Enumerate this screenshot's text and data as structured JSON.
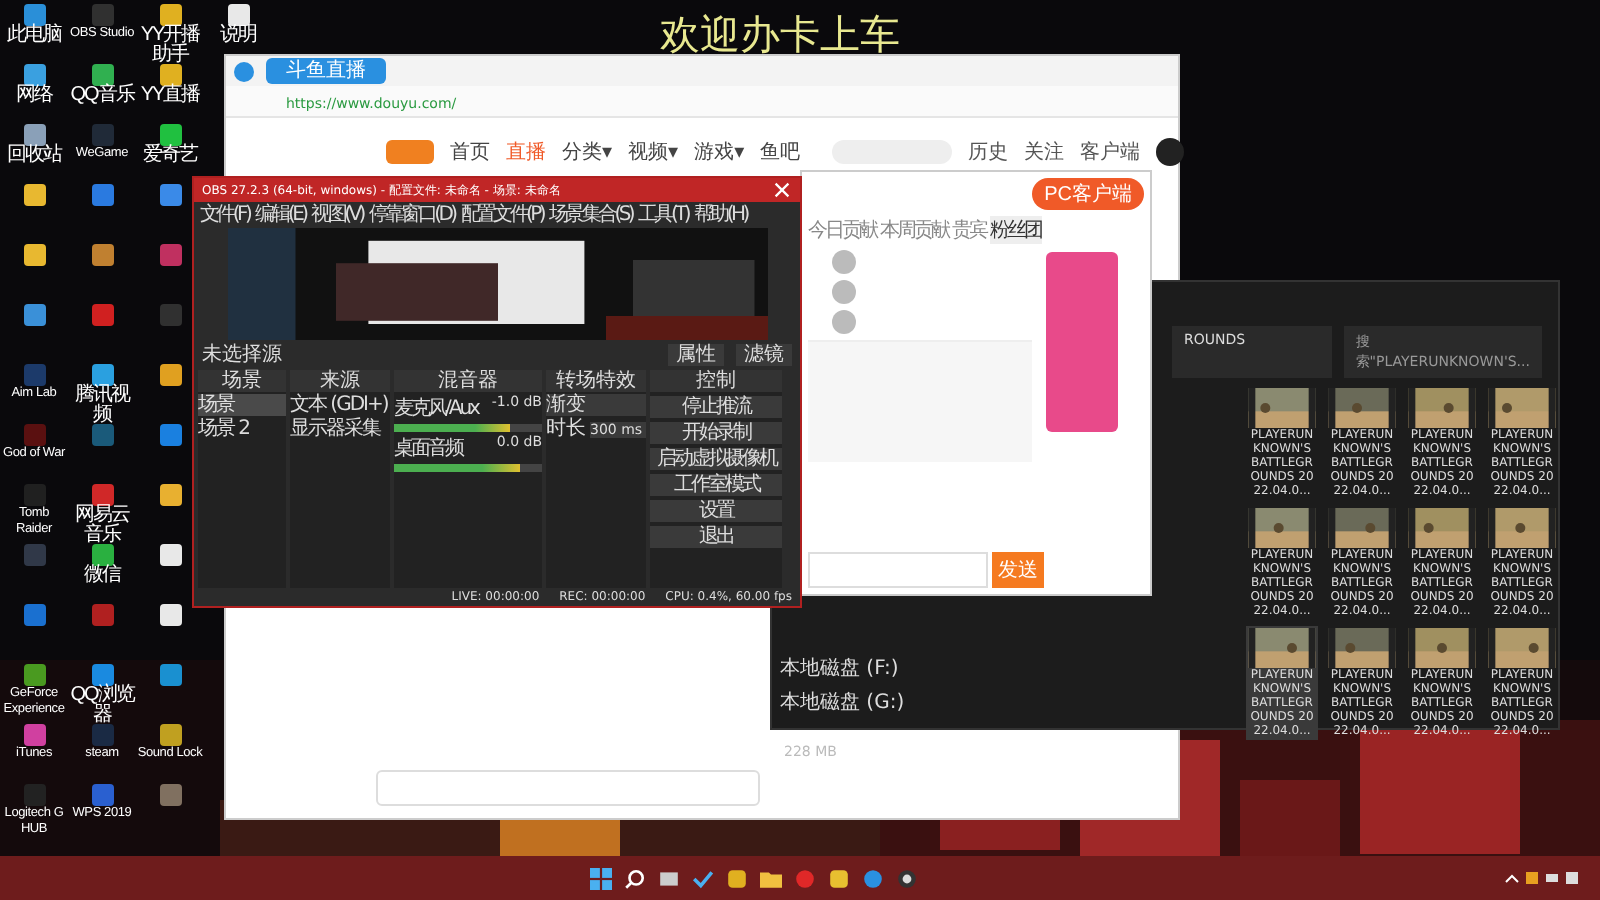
{
  "overlay_title": "欢迎办卡上车",
  "desktop_columns": [
    [
      {
        "label": "此电脑",
        "color": "#2a8fd8"
      },
      {
        "label": "网络",
        "color": "#3aa0e0"
      },
      {
        "label": "回收站",
        "color": "#8aa0b8"
      },
      {
        "color": "#e8b830"
      },
      {
        "color": "#e8b830"
      },
      {
        "color": "#3a90d8"
      },
      {
        "label": "Aim Lab",
        "color": "#1c3a6a"
      },
      {
        "label": "God of War",
        "color": "#5a1010"
      },
      {
        "label": "Tomb Raider",
        "color": "#202020"
      },
      {
        "color": "#303848"
      },
      {
        "color": "#1a70d0"
      },
      {
        "label": "GeForce Experience",
        "color": "#4a9a20"
      },
      {
        "label": "iTunes",
        "color": "#d040a0"
      },
      {
        "label": "Logitech G HUB",
        "color": "#222222"
      }
    ],
    [
      {
        "label": "OBS Studio",
        "color": "#303030"
      },
      {
        "label": "QQ音乐",
        "color": "#30b050"
      },
      {
        "label": "WeGame",
        "color": "#202a38"
      },
      {
        "color": "#2a7ae0"
      },
      {
        "color": "#c08030"
      },
      {
        "color": "#d02020"
      },
      {
        "label": "腾讯视频",
        "color": "#2aa0e0"
      },
      {
        "color": "#1a5a7a"
      },
      {
        "label": "网易云音乐",
        "color": "#d02828"
      },
      {
        "label": "微信",
        "color": "#2ab040"
      },
      {
        "color": "#b02020"
      },
      {
        "label": "QQ浏览器",
        "color": "#1a8ae0"
      },
      {
        "label": "steam",
        "color": "#1a2a44"
      },
      {
        "label": "WPS 2019",
        "color": "#2a60d0"
      }
    ],
    [
      {
        "label": "YY开播助手",
        "color": "#e0b020"
      },
      {
        "label": "YY直播",
        "color": "#e0b020"
      },
      {
        "label": "爱奇艺",
        "color": "#20c040"
      },
      {
        "color": "#3a8ae8"
      },
      {
        "color": "#c03060"
      },
      {
        "color": "#303030"
      },
      {
        "color": "#e0a020"
      },
      {
        "color": "#1a80e0"
      },
      {
        "color": "#e8b030"
      },
      {
        "color": "#e8e8e8"
      },
      {
        "color": "#e8e8e8"
      },
      {
        "color": "#1a90d0"
      },
      {
        "label": "Sound Lock",
        "color": "#c0a020"
      },
      {
        "color": "#807060"
      }
    ],
    [
      {
        "label": "说明",
        "color": "#e8e8e8"
      }
    ]
  ],
  "browser": {
    "tab": "斗鱼直播",
    "url": "https://www.douyu.com/",
    "nav": [
      {
        "label": "首页",
        "selected": false
      },
      {
        "label": "直播",
        "selected": true
      },
      {
        "label": "分类▾",
        "selected": false
      },
      {
        "label": "视频▾",
        "selected": false
      },
      {
        "label": "游戏▾",
        "selected": false
      },
      {
        "label": "鱼吧",
        "selected": false
      }
    ],
    "actions": [
      "历史",
      "关注",
      "客户端"
    ]
  },
  "chat_window": {
    "client_button": "PC客户端",
    "tabs": [
      {
        "label": "今日贡献",
        "selected": false
      },
      {
        "label": "本周贡献",
        "selected": false
      },
      {
        "label": "贵宾",
        "selected": false
      },
      {
        "label": "粉丝团",
        "selected": true
      }
    ],
    "send": "发送"
  },
  "obs": {
    "title": "OBS 27.2.3 (64-bit, windows) - 配置文件: 未命名 - 场景: 未命名",
    "menu": [
      "文件(F)",
      "编辑(E)",
      "视图(V)",
      "停靠窗口(D)",
      "配置文件(P)",
      "场景集合(S)",
      "工具(T)",
      "帮助(H)"
    ],
    "no_source": "未选择源",
    "source_buttons": [
      "属性",
      "滤镜"
    ],
    "panels": {
      "scenes": "场景",
      "sources": "来源",
      "mixer": "混音器",
      "transitions": "转场特效",
      "controls": "控制"
    },
    "scenes": [
      {
        "label": "场景",
        "selected": true
      },
      {
        "label": "场景 2",
        "selected": false
      }
    ],
    "sources": [
      "文本 (GDI+)",
      "显示器采集"
    ],
    "mixer": [
      {
        "name": "麦克风/Aux",
        "reading": "-1.0 dB",
        "level": 0.78
      },
      {
        "name": "桌面音频",
        "reading": "0.0 dB",
        "level": 0.85
      }
    ],
    "transition": {
      "value": "渐变",
      "duration_label": "时长",
      "duration": "300 ms"
    },
    "controls": [
      "停止推流",
      "开始录制",
      "启动虚拟摄像机",
      "工作室模式",
      "设置",
      "退出"
    ],
    "status": [
      "LIVE: 00:00:00",
      "REC: 00:00:00",
      "CPU: 0.4%, 60.00 fps"
    ]
  },
  "explorer": {
    "path": "ROUNDS",
    "search": "搜索\"PLAYERUNKNOWN'S...",
    "drives": [
      "本地磁盘 (F:)",
      "本地磁盘 (G:)"
    ],
    "items": [
      {
        "label": "PLAYERUNKNOWN'S BATTLEGROUNDS 2022.04.0...",
        "selected": false
      },
      {
        "label": "PLAYERUNKNOWN'S BATTLEGROUNDS 2022.04.0...",
        "selected": false
      },
      {
        "label": "PLAYERUNKNOWN'S BATTLEGROUNDS 2022.04.0...",
        "selected": false
      },
      {
        "label": "PLAYERUNKNOWN'S BATTLEGROUNDS 2022.04.0...",
        "selected": false
      },
      {
        "label": "PLAYERUNKNOWN'S BATTLEGROUNDS 2022.04.0...",
        "selected": false
      },
      {
        "label": "PLAYERUNKNOWN'S BATTLEGROUNDS 2022.04.0...",
        "selected": false
      },
      {
        "label": "PLAYERUNKNOWN'S BATTLEGROUNDS 2022.04.0...",
        "selected": false
      },
      {
        "label": "PLAYERUNKNOWN'S BATTLEGROUNDS 2022.04.0...",
        "selected": false
      },
      {
        "label": "PLAYERUNKNOWN'S BATTLEGROUNDS 2022.04.0...",
        "selected": true
      },
      {
        "label": "PLAYERUNKNOWN'S BATTLEGROUNDS 2022.04.0...",
        "selected": false
      },
      {
        "label": "PLAYERUNKNOWN'S BATTLEGROUNDS 2022.04.0...",
        "selected": false
      },
      {
        "label": "PLAYERUNKNOWN'S BATTLEGROUNDS 2022.04.0...",
        "selected": false
      }
    ],
    "status": "228 MB"
  }
}
